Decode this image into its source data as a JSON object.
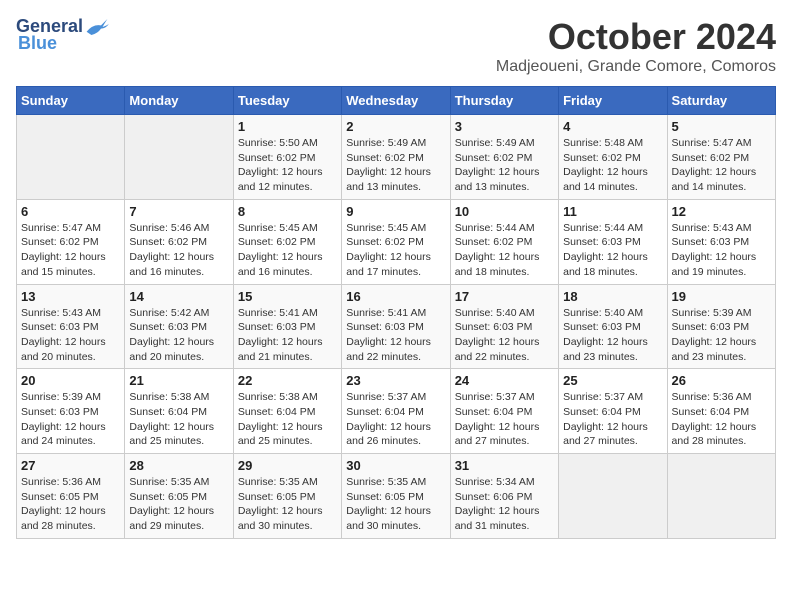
{
  "logo": {
    "general": "General",
    "blue": "Blue"
  },
  "title": "October 2024",
  "location": "Madjeoueni, Grande Comore, Comoros",
  "weekdays": [
    "Sunday",
    "Monday",
    "Tuesday",
    "Wednesday",
    "Thursday",
    "Friday",
    "Saturday"
  ],
  "weeks": [
    [
      {
        "day": "",
        "info": ""
      },
      {
        "day": "",
        "info": ""
      },
      {
        "day": "1",
        "info": "Sunrise: 5:50 AM\nSunset: 6:02 PM\nDaylight: 12 hours and 12 minutes."
      },
      {
        "day": "2",
        "info": "Sunrise: 5:49 AM\nSunset: 6:02 PM\nDaylight: 12 hours and 13 minutes."
      },
      {
        "day": "3",
        "info": "Sunrise: 5:49 AM\nSunset: 6:02 PM\nDaylight: 12 hours and 13 minutes."
      },
      {
        "day": "4",
        "info": "Sunrise: 5:48 AM\nSunset: 6:02 PM\nDaylight: 12 hours and 14 minutes."
      },
      {
        "day": "5",
        "info": "Sunrise: 5:47 AM\nSunset: 6:02 PM\nDaylight: 12 hours and 14 minutes."
      }
    ],
    [
      {
        "day": "6",
        "info": "Sunrise: 5:47 AM\nSunset: 6:02 PM\nDaylight: 12 hours and 15 minutes."
      },
      {
        "day": "7",
        "info": "Sunrise: 5:46 AM\nSunset: 6:02 PM\nDaylight: 12 hours and 16 minutes."
      },
      {
        "day": "8",
        "info": "Sunrise: 5:45 AM\nSunset: 6:02 PM\nDaylight: 12 hours and 16 minutes."
      },
      {
        "day": "9",
        "info": "Sunrise: 5:45 AM\nSunset: 6:02 PM\nDaylight: 12 hours and 17 minutes."
      },
      {
        "day": "10",
        "info": "Sunrise: 5:44 AM\nSunset: 6:02 PM\nDaylight: 12 hours and 18 minutes."
      },
      {
        "day": "11",
        "info": "Sunrise: 5:44 AM\nSunset: 6:03 PM\nDaylight: 12 hours and 18 minutes."
      },
      {
        "day": "12",
        "info": "Sunrise: 5:43 AM\nSunset: 6:03 PM\nDaylight: 12 hours and 19 minutes."
      }
    ],
    [
      {
        "day": "13",
        "info": "Sunrise: 5:43 AM\nSunset: 6:03 PM\nDaylight: 12 hours and 20 minutes."
      },
      {
        "day": "14",
        "info": "Sunrise: 5:42 AM\nSunset: 6:03 PM\nDaylight: 12 hours and 20 minutes."
      },
      {
        "day": "15",
        "info": "Sunrise: 5:41 AM\nSunset: 6:03 PM\nDaylight: 12 hours and 21 minutes."
      },
      {
        "day": "16",
        "info": "Sunrise: 5:41 AM\nSunset: 6:03 PM\nDaylight: 12 hours and 22 minutes."
      },
      {
        "day": "17",
        "info": "Sunrise: 5:40 AM\nSunset: 6:03 PM\nDaylight: 12 hours and 22 minutes."
      },
      {
        "day": "18",
        "info": "Sunrise: 5:40 AM\nSunset: 6:03 PM\nDaylight: 12 hours and 23 minutes."
      },
      {
        "day": "19",
        "info": "Sunrise: 5:39 AM\nSunset: 6:03 PM\nDaylight: 12 hours and 23 minutes."
      }
    ],
    [
      {
        "day": "20",
        "info": "Sunrise: 5:39 AM\nSunset: 6:03 PM\nDaylight: 12 hours and 24 minutes."
      },
      {
        "day": "21",
        "info": "Sunrise: 5:38 AM\nSunset: 6:04 PM\nDaylight: 12 hours and 25 minutes."
      },
      {
        "day": "22",
        "info": "Sunrise: 5:38 AM\nSunset: 6:04 PM\nDaylight: 12 hours and 25 minutes."
      },
      {
        "day": "23",
        "info": "Sunrise: 5:37 AM\nSunset: 6:04 PM\nDaylight: 12 hours and 26 minutes."
      },
      {
        "day": "24",
        "info": "Sunrise: 5:37 AM\nSunset: 6:04 PM\nDaylight: 12 hours and 27 minutes."
      },
      {
        "day": "25",
        "info": "Sunrise: 5:37 AM\nSunset: 6:04 PM\nDaylight: 12 hours and 27 minutes."
      },
      {
        "day": "26",
        "info": "Sunrise: 5:36 AM\nSunset: 6:04 PM\nDaylight: 12 hours and 28 minutes."
      }
    ],
    [
      {
        "day": "27",
        "info": "Sunrise: 5:36 AM\nSunset: 6:05 PM\nDaylight: 12 hours and 28 minutes."
      },
      {
        "day": "28",
        "info": "Sunrise: 5:35 AM\nSunset: 6:05 PM\nDaylight: 12 hours and 29 minutes."
      },
      {
        "day": "29",
        "info": "Sunrise: 5:35 AM\nSunset: 6:05 PM\nDaylight: 12 hours and 30 minutes."
      },
      {
        "day": "30",
        "info": "Sunrise: 5:35 AM\nSunset: 6:05 PM\nDaylight: 12 hours and 30 minutes."
      },
      {
        "day": "31",
        "info": "Sunrise: 5:34 AM\nSunset: 6:06 PM\nDaylight: 12 hours and 31 minutes."
      },
      {
        "day": "",
        "info": ""
      },
      {
        "day": "",
        "info": ""
      }
    ]
  ]
}
